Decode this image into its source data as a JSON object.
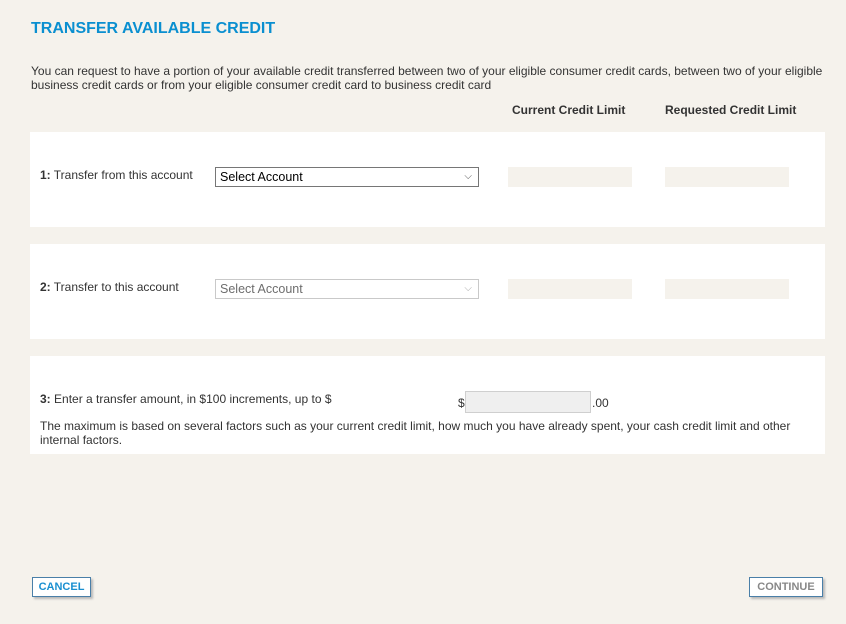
{
  "page": {
    "title": "TRANSFER AVAILABLE CREDIT",
    "intro": "You can request to have a portion of your available credit transferred between two of your eligible consumer credit cards, between two of your eligible business credit cards or from your eligible consumer credit card to business credit card",
    "accent_color": "#0a8fd0"
  },
  "columns": {
    "current": "Current Credit Limit",
    "requested": "Requested Credit Limit"
  },
  "steps": [
    {
      "number": "1:",
      "label": "Transfer from this account",
      "select_value": "Select Account",
      "enabled": true,
      "current_limit": "",
      "requested_limit": ""
    },
    {
      "number": "2:",
      "label": "Transfer to this account",
      "select_value": "Select Account",
      "enabled": false,
      "current_limit": "",
      "requested_limit": ""
    }
  ],
  "amount": {
    "number": "3:",
    "label": "Enter a transfer amount, in $100 increments, up to $",
    "currency_symbol": "$",
    "value": "",
    "cents_suffix": ".00",
    "note": "The maximum is based on several factors such as your current credit limit, how much you have already spent, your cash credit limit and other internal factors."
  },
  "buttons": {
    "cancel": "CANCEL",
    "continue": "CONTINUE"
  },
  "icons": {
    "chevron": "⌵"
  }
}
